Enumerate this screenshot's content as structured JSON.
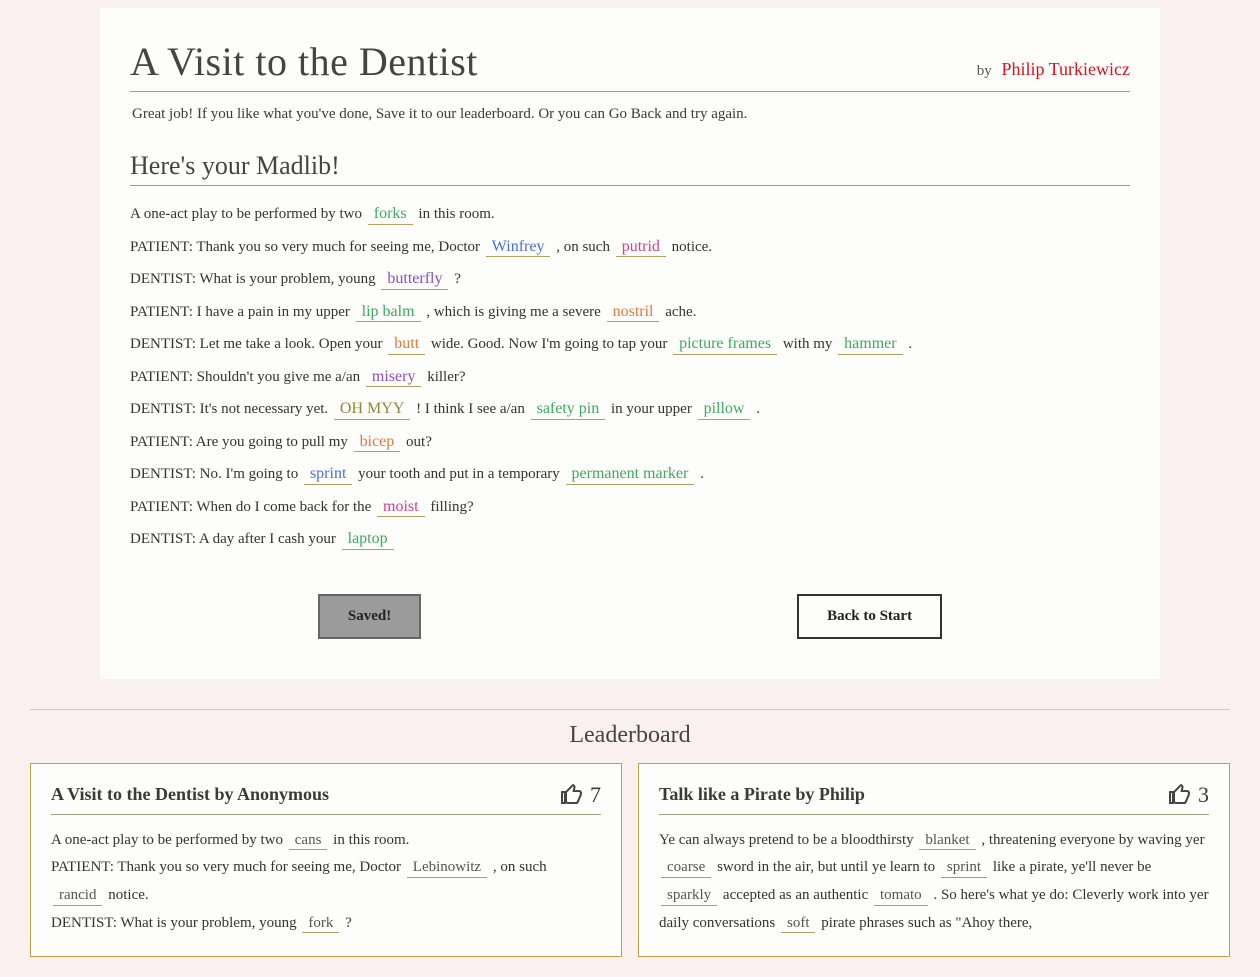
{
  "header": {
    "title": "A Visit to the Dentist",
    "by_label": "by",
    "author": "Philip Turkiewicz"
  },
  "instruction": "Great job! If you like what you've done, Save it to our leaderboard. Or you can Go Back and try again.",
  "section_title": "Here's your Madlib!",
  "story": {
    "l1a": "A one-act play to be performed by two ",
    "b1": "forks",
    "l1b": " in this room.",
    "l2a": "PATIENT: Thank you so very much for seeing me, Doctor ",
    "b2": "Winfrey",
    "l2b": " , on such ",
    "b3": "putrid",
    "l2c": " notice.",
    "l3a": "DENTIST: What is your problem, young ",
    "b4": "butterfly",
    "l3b": " ?",
    "l4a": "PATIENT: I have a pain in my upper ",
    "b5": "lip balm",
    "l4b": " , which is giving me a severe ",
    "b6": "nostril",
    "l4c": " ache.",
    "l5a": "DENTIST: Let me take a look. Open your ",
    "b7": "butt",
    "l5b": " wide. Good. Now I'm going to tap your ",
    "b8": "picture frames",
    "l5c": " with my ",
    "b9": "hammer",
    "l5d": " .",
    "l6a": "PATIENT: Shouldn't you give me a/an ",
    "b10": "misery",
    "l6b": " killer?",
    "l7a": "DENTIST: It's not necessary yet. ",
    "b11": "OH MYY",
    "l7b": " ! I think I see a/an ",
    "b12": "safety pin",
    "l7c": " in your upper ",
    "b13": "pillow",
    "l7d": " .",
    "l8a": "PATIENT: Are you going to pull my ",
    "b14": "bicep",
    "l8b": " out?",
    "l9a": "DENTIST: No. I'm going to ",
    "b15": "sprint",
    "l9b": " your tooth and put in a temporary ",
    "b16": "permanent marker",
    "l9c": " .",
    "l10a": "PATIENT: When do I come back for the ",
    "b17": "moist",
    "l10b": " filling?",
    "l11a": "DENTIST: A day after I cash your ",
    "b18": "laptop"
  },
  "buttons": {
    "saved": "Saved!",
    "back": "Back to Start"
  },
  "leaderboard_title": "Leaderboard",
  "lb": [
    {
      "title": "A Visit to the Dentist by Anonymous",
      "likes": "7",
      "l1a": "A one-act play to be performed by two ",
      "b1": "cans",
      "l1b": " in this room.",
      "l2a": "PATIENT: Thank you so very much for seeing me, Doctor ",
      "b2": "Lebinowitz",
      "l2b": " , on such ",
      "b3": "rancid",
      "l2c": " notice.",
      "l3a": "DENTIST: What is your problem, young ",
      "b4": "fork",
      "l3b": " ?"
    },
    {
      "title": "Talk like a Pirate by Philip",
      "likes": "3",
      "t1": "Ye can always pretend to be a bloodthirsty ",
      "b1": "blanket",
      "t2": " , threatening everyone by waving yer ",
      "b2": "coarse",
      "t3": " sword in the air, but until ye learn to ",
      "b3": "sprint",
      "t4": " like a pirate, ye'll never be ",
      "b4": "sparkly",
      "t5": " accepted as an authentic ",
      "b5": "tomato",
      "t6": " . So here's what ye do: Cleverly work into yer daily conversations ",
      "b6": "soft",
      "t7": " pirate phrases such as \"Ahoy there,"
    }
  ]
}
